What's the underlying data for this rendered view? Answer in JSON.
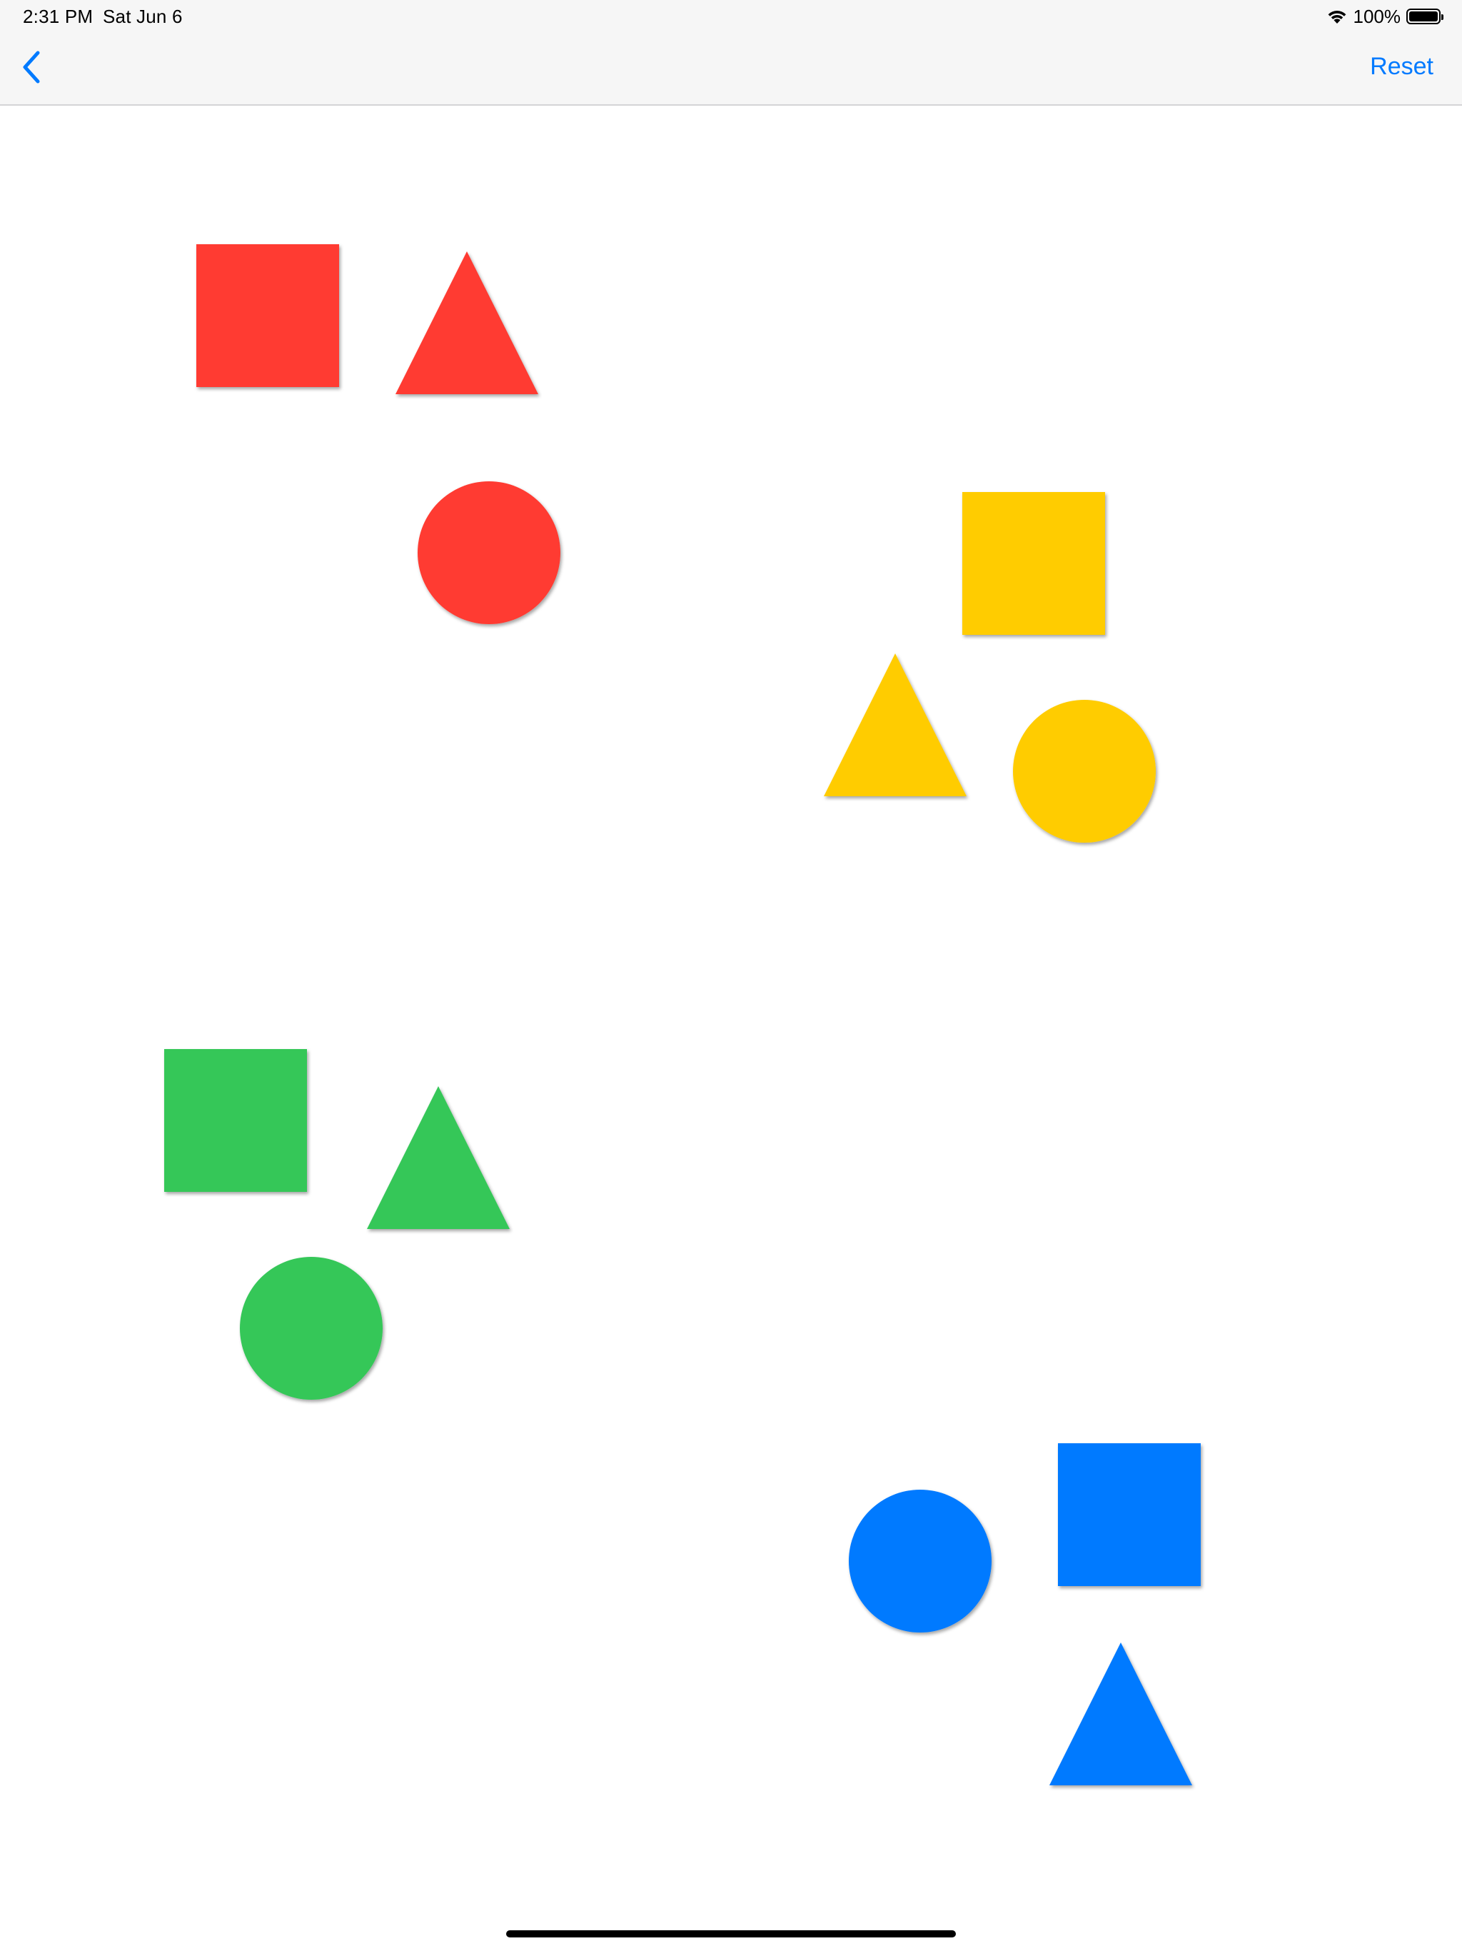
{
  "status_bar": {
    "time": "2:31 PM",
    "date": "Sat Jun 6",
    "battery_percent": "100%",
    "battery_level": 1.0,
    "wifi_icon": "wifi-icon",
    "battery_icon": "battery-icon"
  },
  "nav_bar": {
    "back_icon": "chevron-left-icon",
    "reset_label": "Reset"
  },
  "colors": {
    "red": "#ff3b30",
    "yellow": "#ffcc00",
    "green": "#34c759",
    "blue": "#007aff",
    "tint": "#007aff"
  },
  "shapes": [
    {
      "name": "red-square-shape",
      "kind": "square",
      "color": "red"
    },
    {
      "name": "red-triangle-shape",
      "kind": "triangle",
      "color": "red"
    },
    {
      "name": "red-circle-shape",
      "kind": "circle",
      "color": "red"
    },
    {
      "name": "yellow-square-shape",
      "kind": "square",
      "color": "yellow"
    },
    {
      "name": "yellow-triangle-shape",
      "kind": "triangle",
      "color": "yellow"
    },
    {
      "name": "yellow-circle-shape",
      "kind": "circle",
      "color": "yellow"
    },
    {
      "name": "green-square-shape",
      "kind": "square",
      "color": "green"
    },
    {
      "name": "green-triangle-shape",
      "kind": "triangle",
      "color": "green"
    },
    {
      "name": "green-circle-shape",
      "kind": "circle",
      "color": "green"
    },
    {
      "name": "blue-circle-shape",
      "kind": "circle",
      "color": "blue"
    },
    {
      "name": "blue-square-shape",
      "kind": "square",
      "color": "blue"
    },
    {
      "name": "blue-triangle-shape",
      "kind": "triangle",
      "color": "blue"
    }
  ]
}
